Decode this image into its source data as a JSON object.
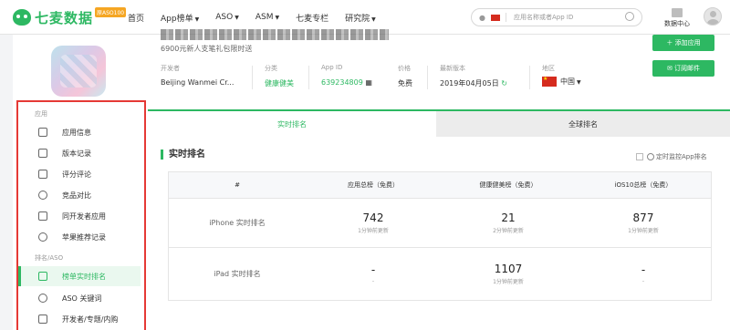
{
  "brand": {
    "name": "七麦数据",
    "badge": "原ASO100"
  },
  "nav": [
    {
      "label": "首页",
      "caret": false
    },
    {
      "label": "App榜单",
      "caret": true
    },
    {
      "label": "ASO",
      "caret": true
    },
    {
      "label": "ASM",
      "caret": true
    },
    {
      "label": "七麦专栏",
      "caret": false
    },
    {
      "label": "研究院",
      "caret": true
    }
  ],
  "search": {
    "placeholder": "应用名称或者App ID",
    "platform_icon": "apple-icon",
    "country_flag": "cn"
  },
  "header_right": {
    "data_center": "数据中心"
  },
  "sidebar": {
    "app_section": "应用",
    "items_app": [
      "应用信息",
      "版本记录",
      "评分评论",
      "竞品对比",
      "同开发者应用",
      "苹果推荐记录"
    ],
    "rank_section": "排名/ASO",
    "items_rank": [
      "榜单实时排名",
      "ASO 关键词",
      "开发者/专题/内购"
    ],
    "active": "榜单实时排名"
  },
  "app": {
    "subtitle": "6900元新人支笔礼包限时送",
    "labels": {
      "developer": "开发者",
      "category": "分类",
      "app_id": "App ID",
      "price": "价格",
      "version": "最新版本",
      "region": "地区"
    },
    "developer": "Beijing Wanmei Cr...",
    "category": "健康健美",
    "app_id": "639234809",
    "price": "免费",
    "version": "2019年04月05日",
    "region": "中国"
  },
  "actions": {
    "add_app": "添加应用",
    "subscribe": "订阅邮件"
  },
  "tabs": [
    "实时排名",
    "全球排名"
  ],
  "ranking": {
    "heading": "实时排名",
    "monitor_label": "定时监控App排名",
    "columns": [
      "#",
      "应用总榜（免费）",
      "健康健美榜（免费）",
      "iOS10总榜（免费）"
    ],
    "rows": [
      {
        "label": "iPhone 实时排名",
        "cells": [
          {
            "v": "742",
            "t": "1分钟前更新"
          },
          {
            "v": "21",
            "t": "2分钟前更新"
          },
          {
            "v": "877",
            "t": "1分钟前更新"
          }
        ]
      },
      {
        "label": "iPad 实时排名",
        "cells": [
          {
            "v": "-",
            "t": "-"
          },
          {
            "v": "1107",
            "t": "1分钟前更新"
          },
          {
            "v": "-",
            "t": "-"
          }
        ]
      }
    ]
  },
  "colors": {
    "accent": "#2db862",
    "highlight_box": "#e53935"
  }
}
